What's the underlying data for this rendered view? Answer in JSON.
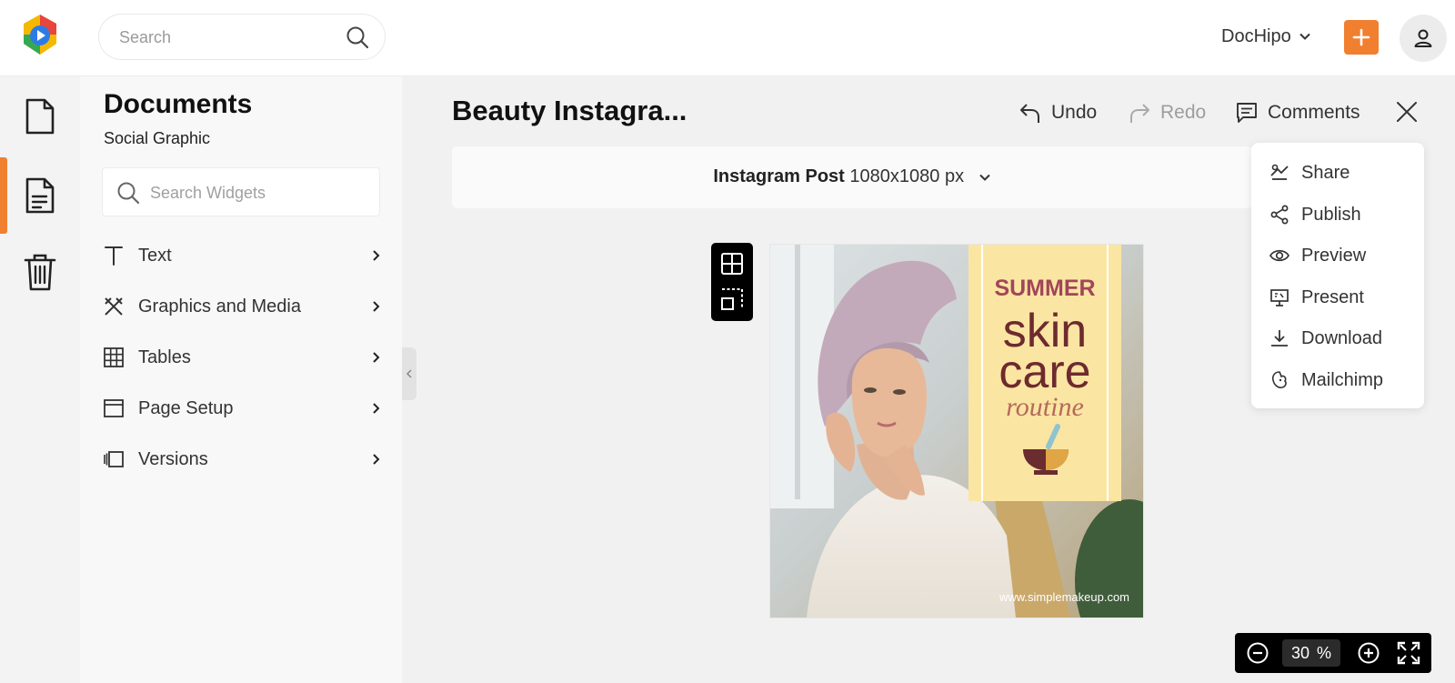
{
  "header": {
    "search_placeholder": "Search",
    "account_label": "DocHipo",
    "accent_color": "#f07f2f"
  },
  "rail": {
    "items": [
      "documents-icon",
      "document-list-icon",
      "trash-icon"
    ],
    "active_index": 1
  },
  "panel": {
    "title": "Documents",
    "subtitle": "Social Graphic",
    "search_placeholder": "Search Widgets",
    "items": [
      {
        "label": "Text",
        "icon": "text-icon"
      },
      {
        "label": "Graphics and Media",
        "icon": "graphics-icon"
      },
      {
        "label": "Tables",
        "icon": "table-icon"
      },
      {
        "label": "Page Setup",
        "icon": "page-setup-icon"
      },
      {
        "label": "Versions",
        "icon": "versions-icon"
      }
    ]
  },
  "workspace": {
    "doc_title": "Beauty Instagra...",
    "undo": "Undo",
    "redo": "Redo",
    "comments": "Comments",
    "size_name": "Instagram Post",
    "size_dims": "1080x1080 px"
  },
  "dropdown": {
    "items": [
      {
        "label": "Share",
        "icon": "share-icon"
      },
      {
        "label": "Publish",
        "icon": "publish-icon"
      },
      {
        "label": "Preview",
        "icon": "preview-eye-icon"
      },
      {
        "label": "Present",
        "icon": "present-icon"
      },
      {
        "label": "Download",
        "icon": "download-icon"
      },
      {
        "label": "Mailchimp",
        "icon": "mailchimp-icon"
      }
    ]
  },
  "design": {
    "line1": "SUMMER",
    "line2": "skin",
    "line3": "care",
    "line4": "routine",
    "url": "www.simplemakeup.com",
    "panel_color": "#fbe5a2",
    "text_color": "#7a2a31"
  },
  "zoom": {
    "value": "30",
    "unit": "%"
  }
}
